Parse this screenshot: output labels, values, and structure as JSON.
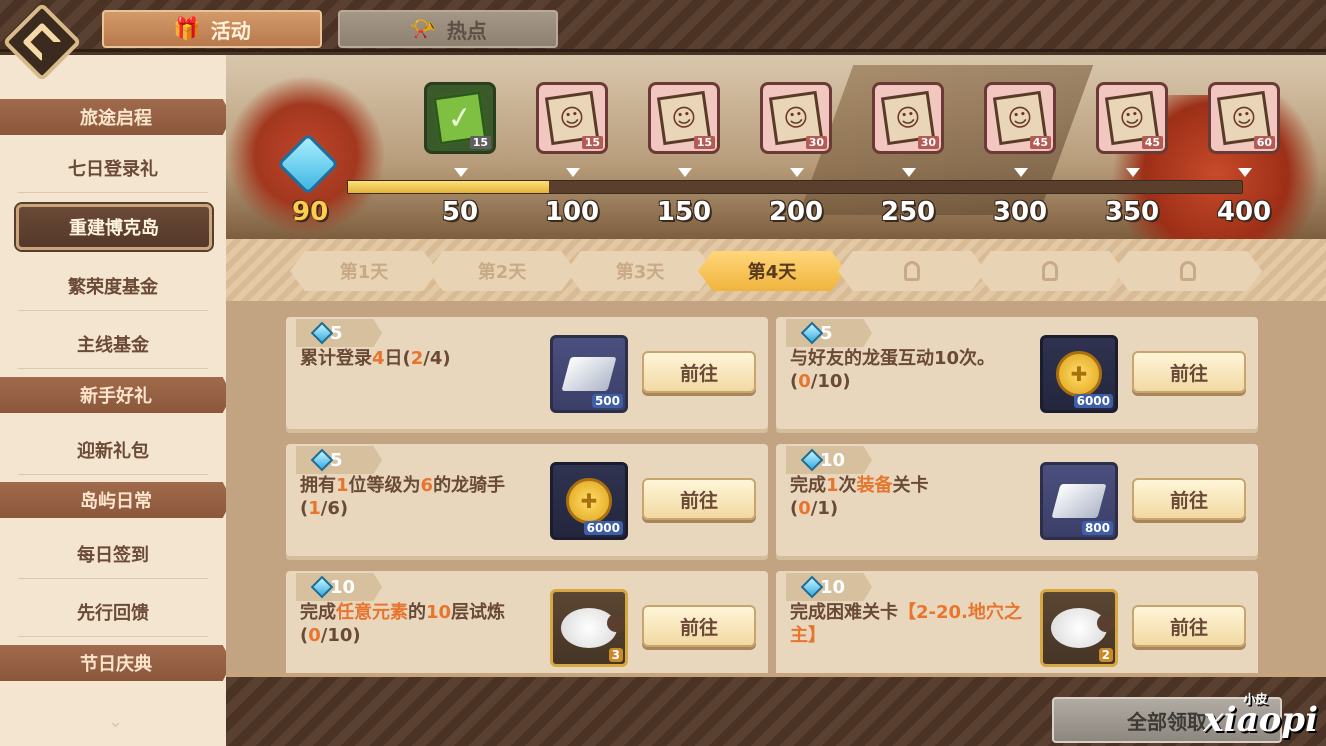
{
  "tabs": [
    {
      "label": "活动",
      "icon": "gift-icon"
    },
    {
      "label": "热点",
      "icon": "horn-icon"
    }
  ],
  "sidebar": {
    "sections": [
      {
        "header": "旅途启程",
        "items": [
          "七日登录礼",
          "重建博克岛",
          "繁荣度基金",
          "主线基金"
        ]
      },
      {
        "header": "新手好礼",
        "items": [
          "迎新礼包"
        ]
      },
      {
        "header": "岛屿日常",
        "items": [
          "每日签到",
          "先行回馈"
        ]
      },
      {
        "header": "节日庆典",
        "items": []
      }
    ],
    "selected": "重建博克岛"
  },
  "progress": {
    "current": "90",
    "fraction": 0.225,
    "milestones": [
      "50",
      "100",
      "150",
      "200",
      "250",
      "300",
      "350",
      "400"
    ],
    "rewards": [
      {
        "count": "15",
        "claimed": true
      },
      {
        "count": "15",
        "claimed": false
      },
      {
        "count": "15",
        "claimed": false
      },
      {
        "count": "30",
        "claimed": false
      },
      {
        "count": "30",
        "claimed": false
      },
      {
        "count": "45",
        "claimed": false
      },
      {
        "count": "45",
        "claimed": false
      },
      {
        "count": "60",
        "claimed": false
      }
    ]
  },
  "days": [
    {
      "label": "第1天",
      "state": "done"
    },
    {
      "label": "第2天",
      "state": "done"
    },
    {
      "label": "第3天",
      "state": "done"
    },
    {
      "label": "第4天",
      "state": "active"
    },
    {
      "label": "",
      "state": "locked"
    },
    {
      "label": "",
      "state": "locked"
    },
    {
      "label": "",
      "state": "locked"
    }
  ],
  "tasks": [
    {
      "points": "5",
      "desc_html": "累计登录<span class=\"hl\">4</span>日(<span class=\"hl\">2</span>/4)",
      "item": "silver",
      "qty": "500",
      "button": "前往"
    },
    {
      "points": "5",
      "desc_html": "与好友的龙蛋互动10次。<br>(<span class=\"hl\">0</span>/10)",
      "item": "gold",
      "qty": "6000",
      "button": "前往"
    },
    {
      "points": "5",
      "desc_html": "拥有<span class=\"hl\">1</span>位等级为<span class=\"hl\">6</span>的龙骑手<br>(<span class=\"hl\">1</span>/6)",
      "item": "gold",
      "qty": "6000",
      "button": "前往"
    },
    {
      "points": "10",
      "desc_html": "完成<span class=\"hl\">1</span>次<span class=\"hl\">装备</span>关卡<br>(<span class=\"hl\">0</span>/1)",
      "item": "silver",
      "qty": "800",
      "button": "前往"
    },
    {
      "points": "10",
      "desc_html": "完成<span class=\"hl\">任意元素</span>的<span class=\"hl\">10</span>层试炼<br>(<span class=\"hl\">0</span>/10)",
      "item": "sheep",
      "qty": "3",
      "button": "前往"
    },
    {
      "points": "10",
      "desc_html": "完成困难关卡<span class=\"hl\">【2-20.地穴之主】</span>",
      "item": "sheep",
      "qty": "2",
      "button": "前往"
    }
  ],
  "bottom": {
    "claim_all": "全部领取"
  },
  "watermark": {
    "main": "xiaopi",
    "small": "小皮"
  }
}
